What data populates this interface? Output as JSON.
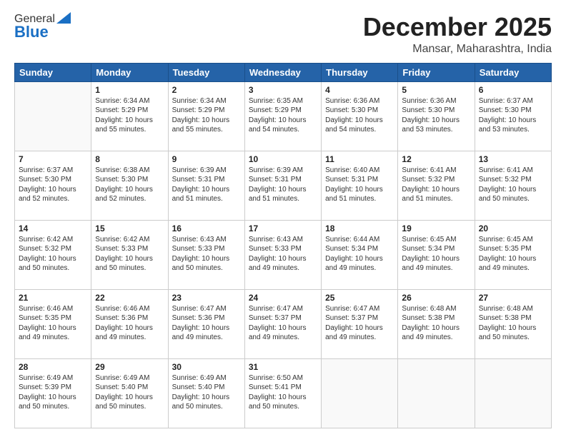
{
  "header": {
    "logo_general": "General",
    "logo_blue": "Blue",
    "month_title": "December 2025",
    "location": "Mansar, Maharashtra, India"
  },
  "days_of_week": [
    "Sunday",
    "Monday",
    "Tuesday",
    "Wednesday",
    "Thursday",
    "Friday",
    "Saturday"
  ],
  "weeks": [
    [
      {
        "day": "",
        "info": ""
      },
      {
        "day": "1",
        "info": "Sunrise: 6:34 AM\nSunset: 5:29 PM\nDaylight: 10 hours\nand 55 minutes."
      },
      {
        "day": "2",
        "info": "Sunrise: 6:34 AM\nSunset: 5:29 PM\nDaylight: 10 hours\nand 55 minutes."
      },
      {
        "day": "3",
        "info": "Sunrise: 6:35 AM\nSunset: 5:29 PM\nDaylight: 10 hours\nand 54 minutes."
      },
      {
        "day": "4",
        "info": "Sunrise: 6:36 AM\nSunset: 5:30 PM\nDaylight: 10 hours\nand 54 minutes."
      },
      {
        "day": "5",
        "info": "Sunrise: 6:36 AM\nSunset: 5:30 PM\nDaylight: 10 hours\nand 53 minutes."
      },
      {
        "day": "6",
        "info": "Sunrise: 6:37 AM\nSunset: 5:30 PM\nDaylight: 10 hours\nand 53 minutes."
      }
    ],
    [
      {
        "day": "7",
        "info": "Sunrise: 6:37 AM\nSunset: 5:30 PM\nDaylight: 10 hours\nand 52 minutes."
      },
      {
        "day": "8",
        "info": "Sunrise: 6:38 AM\nSunset: 5:30 PM\nDaylight: 10 hours\nand 52 minutes."
      },
      {
        "day": "9",
        "info": "Sunrise: 6:39 AM\nSunset: 5:31 PM\nDaylight: 10 hours\nand 51 minutes."
      },
      {
        "day": "10",
        "info": "Sunrise: 6:39 AM\nSunset: 5:31 PM\nDaylight: 10 hours\nand 51 minutes."
      },
      {
        "day": "11",
        "info": "Sunrise: 6:40 AM\nSunset: 5:31 PM\nDaylight: 10 hours\nand 51 minutes."
      },
      {
        "day": "12",
        "info": "Sunrise: 6:41 AM\nSunset: 5:32 PM\nDaylight: 10 hours\nand 51 minutes."
      },
      {
        "day": "13",
        "info": "Sunrise: 6:41 AM\nSunset: 5:32 PM\nDaylight: 10 hours\nand 50 minutes."
      }
    ],
    [
      {
        "day": "14",
        "info": "Sunrise: 6:42 AM\nSunset: 5:32 PM\nDaylight: 10 hours\nand 50 minutes."
      },
      {
        "day": "15",
        "info": "Sunrise: 6:42 AM\nSunset: 5:33 PM\nDaylight: 10 hours\nand 50 minutes."
      },
      {
        "day": "16",
        "info": "Sunrise: 6:43 AM\nSunset: 5:33 PM\nDaylight: 10 hours\nand 50 minutes."
      },
      {
        "day": "17",
        "info": "Sunrise: 6:43 AM\nSunset: 5:33 PM\nDaylight: 10 hours\nand 49 minutes."
      },
      {
        "day": "18",
        "info": "Sunrise: 6:44 AM\nSunset: 5:34 PM\nDaylight: 10 hours\nand 49 minutes."
      },
      {
        "day": "19",
        "info": "Sunrise: 6:45 AM\nSunset: 5:34 PM\nDaylight: 10 hours\nand 49 minutes."
      },
      {
        "day": "20",
        "info": "Sunrise: 6:45 AM\nSunset: 5:35 PM\nDaylight: 10 hours\nand 49 minutes."
      }
    ],
    [
      {
        "day": "21",
        "info": "Sunrise: 6:46 AM\nSunset: 5:35 PM\nDaylight: 10 hours\nand 49 minutes."
      },
      {
        "day": "22",
        "info": "Sunrise: 6:46 AM\nSunset: 5:36 PM\nDaylight: 10 hours\nand 49 minutes."
      },
      {
        "day": "23",
        "info": "Sunrise: 6:47 AM\nSunset: 5:36 PM\nDaylight: 10 hours\nand 49 minutes."
      },
      {
        "day": "24",
        "info": "Sunrise: 6:47 AM\nSunset: 5:37 PM\nDaylight: 10 hours\nand 49 minutes."
      },
      {
        "day": "25",
        "info": "Sunrise: 6:47 AM\nSunset: 5:37 PM\nDaylight: 10 hours\nand 49 minutes."
      },
      {
        "day": "26",
        "info": "Sunrise: 6:48 AM\nSunset: 5:38 PM\nDaylight: 10 hours\nand 49 minutes."
      },
      {
        "day": "27",
        "info": "Sunrise: 6:48 AM\nSunset: 5:38 PM\nDaylight: 10 hours\nand 50 minutes."
      }
    ],
    [
      {
        "day": "28",
        "info": "Sunrise: 6:49 AM\nSunset: 5:39 PM\nDaylight: 10 hours\nand 50 minutes."
      },
      {
        "day": "29",
        "info": "Sunrise: 6:49 AM\nSunset: 5:40 PM\nDaylight: 10 hours\nand 50 minutes."
      },
      {
        "day": "30",
        "info": "Sunrise: 6:49 AM\nSunset: 5:40 PM\nDaylight: 10 hours\nand 50 minutes."
      },
      {
        "day": "31",
        "info": "Sunrise: 6:50 AM\nSunset: 5:41 PM\nDaylight: 10 hours\nand 50 minutes."
      },
      {
        "day": "",
        "info": ""
      },
      {
        "day": "",
        "info": ""
      },
      {
        "day": "",
        "info": ""
      }
    ]
  ]
}
